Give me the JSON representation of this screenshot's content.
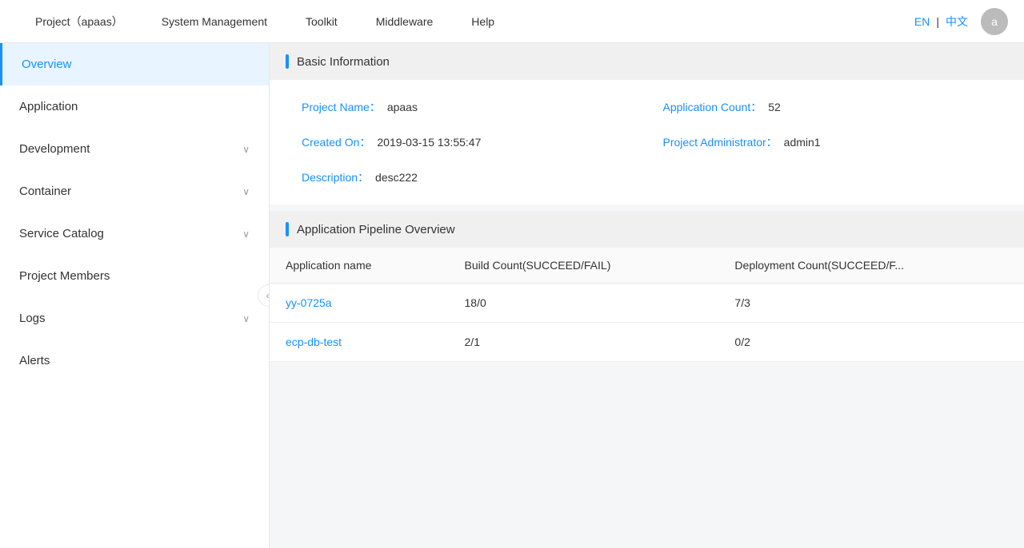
{
  "nav": {
    "items": [
      {
        "label": "Project（apaas）"
      },
      {
        "label": "System Management"
      },
      {
        "label": "Toolkit"
      },
      {
        "label": "Middleware"
      },
      {
        "label": "Help"
      }
    ],
    "lang_en": "EN",
    "lang_separator": "|",
    "lang_zh": "中文",
    "avatar_label": "a"
  },
  "sidebar": {
    "items": [
      {
        "label": "Overview",
        "active": true,
        "has_chevron": false
      },
      {
        "label": "Application",
        "active": false,
        "has_chevron": false
      },
      {
        "label": "Development",
        "active": false,
        "has_chevron": true
      },
      {
        "label": "Container",
        "active": false,
        "has_chevron": true
      },
      {
        "label": "Service Catalog",
        "active": false,
        "has_chevron": true
      },
      {
        "label": "Project Members",
        "active": false,
        "has_chevron": false
      },
      {
        "label": "Logs",
        "active": false,
        "has_chevron": true
      },
      {
        "label": "Alerts",
        "active": false,
        "has_chevron": false
      }
    ],
    "collapse_icon": "«"
  },
  "basic_info": {
    "section_title": "Basic Information",
    "fields": [
      {
        "label": "Project Name：",
        "value": "apaas"
      },
      {
        "label": "Application Count：",
        "value": "52"
      },
      {
        "label": "Created On：",
        "value": "2019-03-15 13:55:47"
      },
      {
        "label": "Project Administrator：",
        "value": "admin1"
      },
      {
        "label": "Description：",
        "value": "desc222"
      }
    ]
  },
  "pipeline": {
    "section_title": "Application Pipeline Overview",
    "table": {
      "headers": [
        "Application name",
        "Build Count(SUCCEED/FAIL)",
        "Deployment Count(SUCCEED/F..."
      ],
      "rows": [
        {
          "app_name": "yy-0725a",
          "build_count": "18/0",
          "deploy_count": "7/3"
        },
        {
          "app_name": "ecp-db-test",
          "build_count": "2/1",
          "deploy_count": "0/2"
        }
      ]
    }
  }
}
